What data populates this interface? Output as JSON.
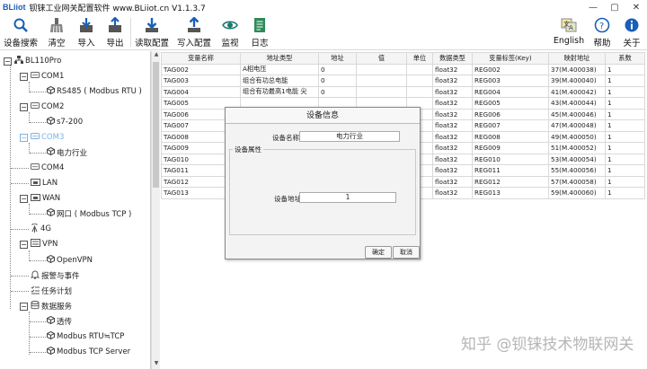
{
  "app": {
    "logo": "BLiiot",
    "title": "钡铼工业网关配置软件 www.BLiiot.cn V1.1.3.7",
    "window_buttons": [
      "—",
      "▢",
      "✕"
    ]
  },
  "toolbar": {
    "search": "设备搜索",
    "clear": "清空",
    "import": "导入",
    "export": "导出",
    "read_config": "读取配置",
    "write_config": "写入配置",
    "monitor": "监视",
    "log": "日志",
    "english": "English",
    "help": "帮助",
    "about": "关于"
  },
  "tree": {
    "root": "BL110Pro",
    "com1": "COM1",
    "com1_child": "RS485 ( Modbus RTU )",
    "com2": "COM2",
    "com2_child": "s7-200",
    "com3": "COM3",
    "com3_child": "电力行业",
    "com4": "COM4",
    "lan": "LAN",
    "wan": "WAN",
    "wan_child": "网口 ( Modbus TCP )",
    "g4": "4G",
    "vpn": "VPN",
    "vpn_child": "OpenVPN",
    "alarm": "报警与事件",
    "task": "任务计划",
    "data_service": "数据服务",
    "ds_transparent": "透传",
    "ds_rtu_tcp": "Modbus RTU≒TCP",
    "ds_tcp_server": "Modbus TCP Server"
  },
  "table": {
    "headers": [
      "变量名称",
      "地址类型",
      "地址",
      "值",
      "单位",
      "数据类型",
      "变量标签(Key)",
      "映射地址",
      "系数"
    ],
    "rows": [
      [
        "TAG002",
        "A相电压",
        "0",
        "",
        "",
        "float32",
        "REG002",
        "37(M.400038)",
        "1"
      ],
      [
        "TAG003",
        "组合有功总电能",
        "0",
        "",
        "",
        "float32",
        "REG003",
        "39(M.400040)",
        "1"
      ],
      [
        "TAG004",
        "组合有功最高1电能 尖",
        "0",
        "",
        "",
        "float32",
        "REG004",
        "41(M.400042)",
        "1"
      ],
      [
        "TAG005",
        "",
        "",
        "",
        "",
        "float32",
        "REG005",
        "43(M.400044)",
        "1"
      ],
      [
        "TAG006",
        "",
        "",
        "",
        "",
        "float32",
        "REG006",
        "45(M.400046)",
        "1"
      ],
      [
        "TAG007",
        "",
        "",
        "",
        "",
        "float32",
        "REG007",
        "47(M.400048)",
        "1"
      ],
      [
        "TAG008",
        "",
        "",
        "",
        "",
        "float32",
        "REG008",
        "49(M.400050)",
        "1"
      ],
      [
        "TAG009",
        "",
        "",
        "",
        "",
        "float32",
        "REG009",
        "51(M.400052)",
        "1"
      ],
      [
        "TAG010",
        "",
        "",
        "",
        "",
        "float32",
        "REG010",
        "53(M.400054)",
        "1"
      ],
      [
        "TAG011",
        "",
        "",
        "",
        "",
        "float32",
        "REG011",
        "55(M.400056)",
        "1"
      ],
      [
        "TAG012",
        "",
        "",
        "",
        "",
        "float32",
        "REG012",
        "57(M.400058)",
        "1"
      ],
      [
        "TAG013",
        "",
        "",
        "",
        "",
        "float32",
        "REG013",
        "59(M.400060)",
        "1"
      ]
    ]
  },
  "dialog": {
    "title": "设备信息",
    "name_label": "设备名称",
    "name_value": "电力行业",
    "group_label": "设备属性",
    "addr_label": "设备地址",
    "addr_value": "1",
    "ok": "确定",
    "cancel": "取消"
  },
  "watermark": "知乎 @钡铼技术物联网关",
  "colors": {
    "accent": "#1b5fb6",
    "tree_disabled": "#7fb2e0"
  }
}
